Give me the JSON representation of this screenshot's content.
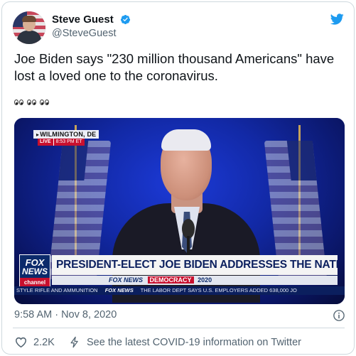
{
  "author": {
    "name": "Steve Guest",
    "handle": "@SteveGuest",
    "verified": true
  },
  "tweet": {
    "text": "Joe Biden says \"230 million thousand Americans\" have lost a loved one to the coronavirus.",
    "emojis": [
      "eyes",
      "eyes",
      "eyes"
    ]
  },
  "media": {
    "location": "WILMINGTON, DE",
    "live_label": "LIVE",
    "live_time": "8:53 PM ET",
    "network_logo": [
      "FOX",
      "NEWS",
      "channel"
    ],
    "headline": "PRESIDENT-ELECT JOE BIDEN ADDRESSES THE NATION",
    "subbar_network": "FOX NEWS",
    "subbar_tag": "DEMOCRACY",
    "subbar_year": "2020",
    "ticker_left": "STYLE RIFLE AND AMMUNITION",
    "ticker_network": "FOX NEWS",
    "ticker_right": "THE LABOR DEPT SAYS U.S. EMPLOYERS ADDED 638,000 JO"
  },
  "meta": {
    "timestamp": "9:58 AM · Nov 8, 2020"
  },
  "footer": {
    "likes": "2.2K",
    "covid_link": "See the latest COVID-19 information on Twitter"
  },
  "colors": {
    "twitter_blue": "#1d9bf0",
    "secondary_text": "#536471",
    "fox_red": "#c8102e",
    "fox_navy": "#0b1f5e"
  }
}
